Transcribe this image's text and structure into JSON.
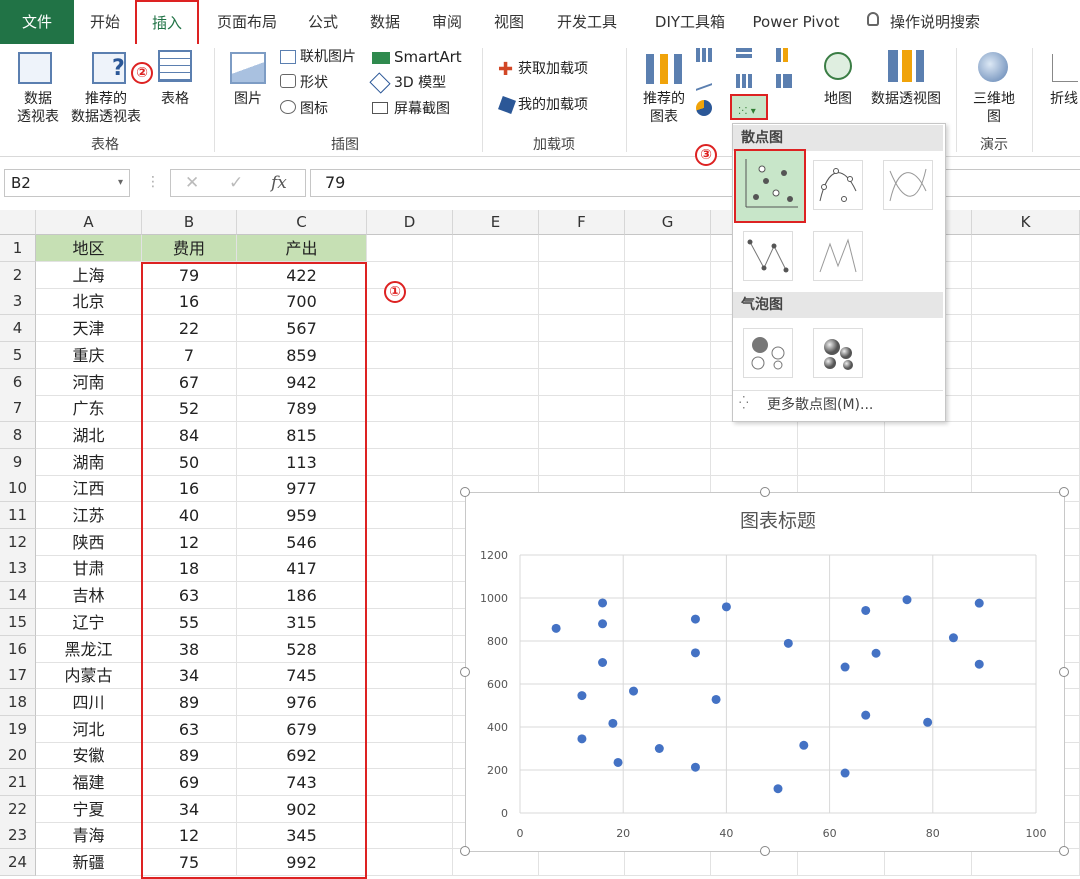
{
  "tabs": [
    "文件",
    "开始",
    "插入",
    "页面布局",
    "公式",
    "数据",
    "审阅",
    "视图",
    "开发工具",
    "DIY工具箱",
    "Power Pivot",
    "操作说明搜索"
  ],
  "ribbon": {
    "table_group": {
      "label": "表格",
      "pivot": "数据\n透视表",
      "recommended_pivot": "推荐的\n数据透视表",
      "table": "表格"
    },
    "illustrations": {
      "label": "插图",
      "picture": "图片",
      "online_picture": "联机图片",
      "shapes": "形状",
      "icons": "图标",
      "smartart": "SmartArt",
      "model3d": "3D 模型",
      "screenshot": "屏幕截图"
    },
    "addins": {
      "label": "加载项",
      "get": "获取加载项",
      "mine": "我的加载项"
    },
    "charts": {
      "recommended": "推荐的\n图表",
      "map": "地图",
      "pivot_chart": "数据透视图"
    },
    "tours": {
      "label": "演示",
      "map3d": "三维地\n图"
    },
    "sparklines": {
      "line": "折线"
    }
  },
  "formula_bar": {
    "name_box": "B2",
    "fx": "fx",
    "value": "79"
  },
  "columns": [
    "A",
    "B",
    "C",
    "D",
    "E",
    "F",
    "G",
    "H",
    "I",
    "J",
    "K"
  ],
  "table": {
    "headers": [
      "地区",
      "费用",
      "产出"
    ],
    "rows": [
      [
        "上海",
        "79",
        "422"
      ],
      [
        "北京",
        "16",
        "700"
      ],
      [
        "天津",
        "22",
        "567"
      ],
      [
        "重庆",
        "7",
        "859"
      ],
      [
        "河南",
        "67",
        "942"
      ],
      [
        "广东",
        "52",
        "789"
      ],
      [
        "湖北",
        "84",
        "815"
      ],
      [
        "湖南",
        "50",
        "113"
      ],
      [
        "江西",
        "16",
        "977"
      ],
      [
        "江苏",
        "40",
        "959"
      ],
      [
        "陕西",
        "12",
        "546"
      ],
      [
        "甘肃",
        "18",
        "417"
      ],
      [
        "吉林",
        "63",
        "186"
      ],
      [
        "辽宁",
        "55",
        "315"
      ],
      [
        "黑龙江",
        "38",
        "528"
      ],
      [
        "内蒙古",
        "34",
        "745"
      ],
      [
        "四川",
        "89",
        "976"
      ],
      [
        "河北",
        "63",
        "679"
      ],
      [
        "安徽",
        "89",
        "692"
      ],
      [
        "福建",
        "69",
        "743"
      ],
      [
        "宁夏",
        "34",
        "902"
      ],
      [
        "青海",
        "12",
        "345"
      ],
      [
        "新疆",
        "75",
        "992"
      ]
    ]
  },
  "dropdown": {
    "scatter_title": "散点图",
    "bubble_title": "气泡图",
    "more": "更多散点图(M)..."
  },
  "annotations": [
    "①",
    "②",
    "③"
  ],
  "chart_data": {
    "type": "scatter",
    "title": "图表标题",
    "xlim": [
      0,
      100
    ],
    "ylim": [
      0,
      1200
    ],
    "xticks": [
      0,
      20,
      40,
      60,
      80,
      100
    ],
    "yticks": [
      0,
      200,
      400,
      600,
      800,
      1000,
      1200
    ],
    "grid": true,
    "color": "#4472c4",
    "points": [
      [
        79,
        422
      ],
      [
        16,
        700
      ],
      [
        22,
        567
      ],
      [
        7,
        859
      ],
      [
        67,
        942
      ],
      [
        52,
        789
      ],
      [
        84,
        815
      ],
      [
        50,
        113
      ],
      [
        16,
        977
      ],
      [
        40,
        959
      ],
      [
        12,
        546
      ],
      [
        18,
        417
      ],
      [
        63,
        186
      ],
      [
        55,
        315
      ],
      [
        38,
        528
      ],
      [
        34,
        745
      ],
      [
        89,
        976
      ],
      [
        63,
        679
      ],
      [
        89,
        692
      ],
      [
        69,
        743
      ],
      [
        34,
        902
      ],
      [
        12,
        345
      ],
      [
        75,
        992
      ],
      [
        16,
        880
      ],
      [
        67,
        455
      ],
      [
        27,
        300
      ],
      [
        34,
        213
      ],
      [
        19,
        235
      ]
    ]
  }
}
